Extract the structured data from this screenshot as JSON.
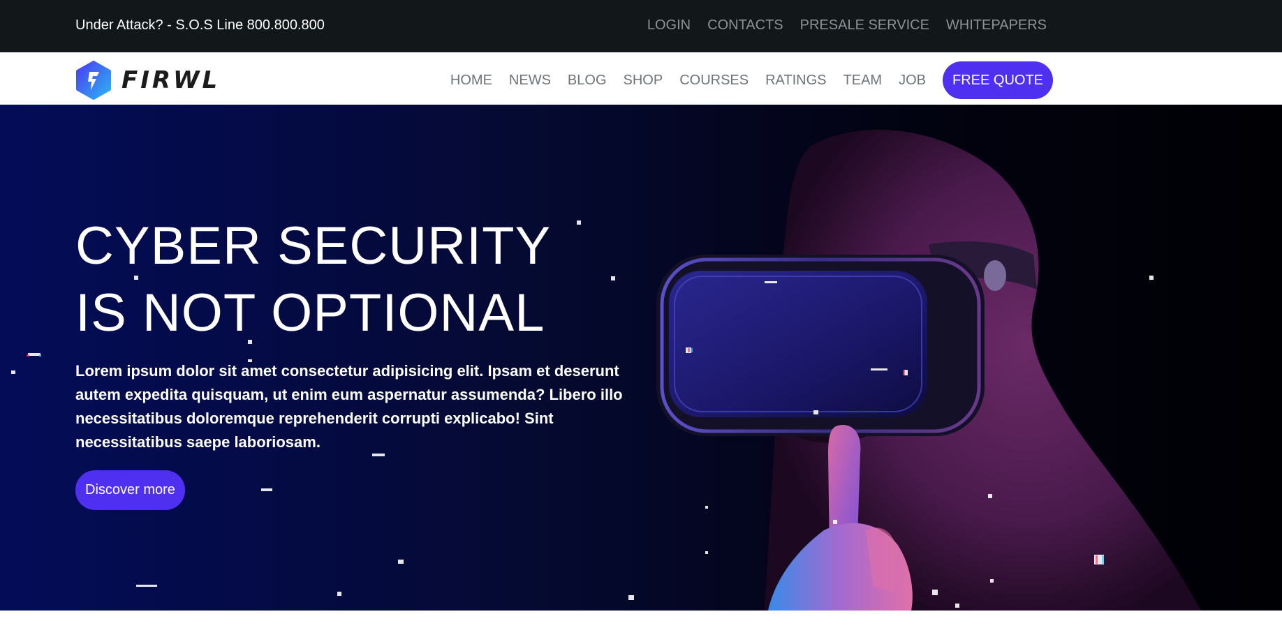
{
  "topbar": {
    "sos_text": "Under Attack? - S.O.S Line 800.800.800",
    "links": [
      "LOGIN",
      "CONTACTS",
      "PRESALE SERVICE",
      "WHITEPAPERS"
    ]
  },
  "brand": {
    "name": "FIRWL",
    "logo_icon": "lightning-hexagon-icon"
  },
  "nav": {
    "items": [
      "HOME",
      "NEWS",
      "BLOG",
      "SHOP",
      "COURSES",
      "RATINGS",
      "TEAM",
      "JOB"
    ],
    "cta_label": "FREE QUOTE"
  },
  "hero": {
    "title": "CYBER SECURITY IS NOT OPTIONAL",
    "lead": "Lorem ipsum dolor sit amet consectetur adipisicing elit. Ipsam et deserunt autem expedita quisquam, ut enim eum aspernatur assumenda? Libero illo necessitatibus doloremque reprehenderit corrupti explicabo! Sint necessitatibus saepe laboriosam.",
    "button_label": "Discover more",
    "image": "hooded-person-vr-headset"
  },
  "colors": {
    "topbar_bg": "#12171a",
    "accent": "#5030f0",
    "hero_bg_left": "#040c58",
    "hero_bg_right": "#000004",
    "nav_text": "#6d7378"
  }
}
